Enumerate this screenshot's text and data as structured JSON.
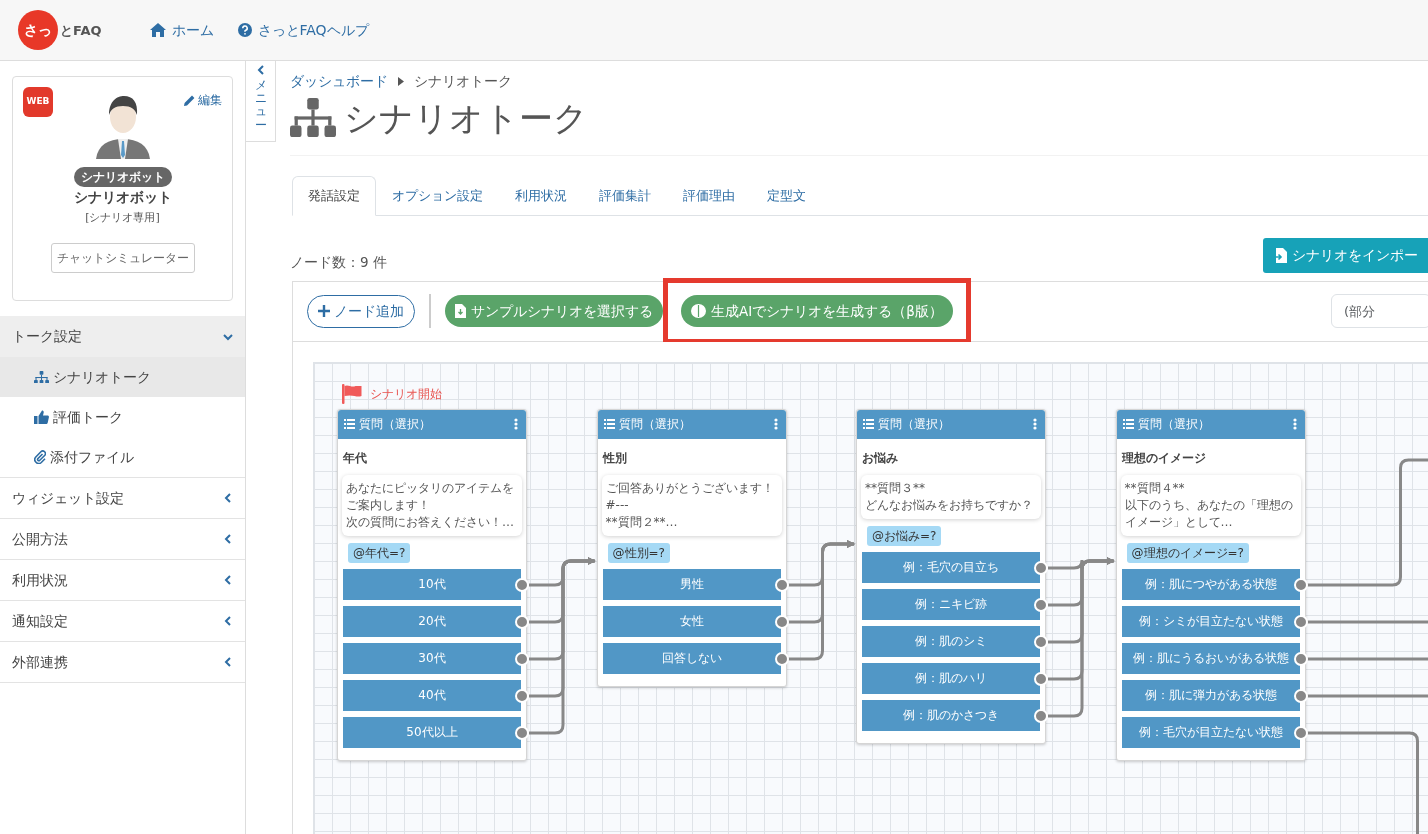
{
  "header": {
    "logo": {
      "mark": "さっ",
      "text": "とFAQ"
    },
    "links": [
      {
        "label": "ホーム"
      },
      {
        "label": "さっとFAQヘルプ"
      }
    ]
  },
  "profile": {
    "badge": "WEB",
    "edit": "編集",
    "role_badge": "シナリオボット",
    "name": "シナリオボット",
    "subtitle": "[シナリオ専用]",
    "simulator_button": "チャットシミュレーター"
  },
  "sidebar": {
    "items": [
      {
        "label": "トーク設定",
        "expanded": true,
        "children": [
          {
            "label": "シナリオトーク",
            "selected": true
          },
          {
            "label": "評価トーク",
            "selected": false
          },
          {
            "label": "添付ファイル",
            "selected": false
          }
        ]
      },
      {
        "label": "ウィジェット設定",
        "expanded": false
      },
      {
        "label": "公開方法",
        "expanded": false
      },
      {
        "label": "利用状況",
        "expanded": false
      },
      {
        "label": "通知設定",
        "expanded": false
      },
      {
        "label": "外部連携",
        "expanded": false
      }
    ]
  },
  "menu_toggle": "メニュー",
  "breadcrumb": [
    "ダッシュボード",
    "シナリオトーク"
  ],
  "page_title": "シナリオトーク",
  "tabs": [
    {
      "label": "発話設定",
      "selected": true
    },
    {
      "label": "オプション設定",
      "selected": false
    },
    {
      "label": "利用状況",
      "selected": false
    },
    {
      "label": "評価集計",
      "selected": false
    },
    {
      "label": "評価理由",
      "selected": false
    },
    {
      "label": "定型文",
      "selected": false
    }
  ],
  "node_count": "ノード数：9 件",
  "import_button": "シナリオをインポー",
  "toolbar": {
    "add_node": "ノード追加",
    "sample_button": "サンプルシナリオを選択する",
    "generate_button": {
      "label": "生成AIでシナリオを生成する（β版）",
      "highlighted": true
    },
    "search": {
      "placeholder": "(部分"
    }
  },
  "canvas": {
    "start_label": "シナリオ開始",
    "nodes": [
      {
        "header": "質問（選択）",
        "title": "年代",
        "message_lines": [
          "あなたにピッタリのアイテムを",
          "ご案内します！",
          "次の質問にお答えください！…"
        ],
        "variable": "@年代=?",
        "options": [
          "10代",
          "20代",
          "30代",
          "40代",
          "50代以上"
        ]
      },
      {
        "header": "質問（選択）",
        "title": "性別",
        "message_lines": [
          "ご回答ありがとうございます！",
          "#---",
          "**質問２**…"
        ],
        "variable": "@性別=?",
        "options": [
          "男性",
          "女性",
          "回答しない"
        ]
      },
      {
        "header": "質問（選択）",
        "title": "お悩み",
        "message_lines": [
          "**質問３**",
          "どんなお悩みをお持ちですか？"
        ],
        "variable": "@お悩み=?",
        "options": [
          "例：毛穴の目立ち",
          "例：ニキビ跡",
          "例：肌のシミ",
          "例：肌のハリ",
          "例：肌のかさつき"
        ]
      },
      {
        "header": "質問（選択）",
        "title": "理想のイメージ",
        "message_lines": [
          "**質問４**",
          "以下のうち、あなたの「理想の",
          "イメージ」として…"
        ],
        "variable": "@理想のイメージ=?",
        "options": [
          "例：肌につやがある状態",
          "例：シミが目立たない状態",
          "例：肌にうるおいがある状態",
          "例：肌に弾力がある状態",
          "例：毛穴が目立たない状態"
        ]
      }
    ]
  }
}
